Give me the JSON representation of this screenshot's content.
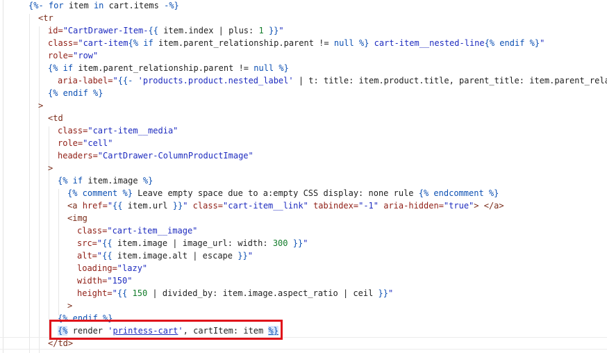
{
  "editor": {
    "highlight_color": "#e0131a",
    "lines": [
      [
        [
          "lq",
          "{%- "
        ],
        [
          "kw",
          "for"
        ],
        [
          "var",
          " item "
        ],
        [
          "kw",
          "in"
        ],
        [
          "var",
          " cart.items "
        ],
        [
          "lq",
          "-%}"
        ]
      ],
      [
        [
          "tag",
          "<tr"
        ]
      ],
      [
        [
          "attr",
          "id="
        ],
        [
          "str",
          "\"CartDrawer-Item-"
        ],
        [
          "lq",
          "{{"
        ],
        [
          "var",
          " item.index "
        ],
        [
          "txt",
          "| "
        ],
        [
          "flt",
          "plus"
        ],
        [
          "txt",
          ": "
        ],
        [
          "num",
          "1"
        ],
        [
          "lq",
          " }}"
        ],
        [
          "str",
          "\""
        ]
      ],
      [
        [
          "attr",
          "class="
        ],
        [
          "str",
          "\"cart-item"
        ],
        [
          "lq",
          "{%"
        ],
        [
          "kw",
          " if"
        ],
        [
          "var",
          " item.parent_relationship.parent "
        ],
        [
          "txt",
          "!= "
        ],
        [
          "kw",
          "null"
        ],
        [
          "lq",
          " %}"
        ],
        [
          "str",
          " cart-item__nested-line"
        ],
        [
          "lq",
          "{%"
        ],
        [
          "kw",
          " endif"
        ],
        [
          "lq",
          " %}"
        ],
        [
          "str",
          "\""
        ]
      ],
      [
        [
          "attr",
          "role="
        ],
        [
          "str",
          "\"row\""
        ]
      ],
      [
        [
          "lq",
          "{%"
        ],
        [
          "kw",
          " if"
        ],
        [
          "var",
          " item.parent_relationship.parent "
        ],
        [
          "txt",
          "!= "
        ],
        [
          "kw",
          "null"
        ],
        [
          "lq",
          " %}"
        ]
      ],
      [
        [
          "attr",
          "aria-label="
        ],
        [
          "str",
          "\""
        ],
        [
          "lq",
          "{{-"
        ],
        [
          "str",
          " 'products.product.nested_label'"
        ],
        [
          "txt",
          " | "
        ],
        [
          "flt",
          "t"
        ],
        [
          "txt",
          ": "
        ],
        [
          "flt",
          "title"
        ],
        [
          "txt",
          ": "
        ],
        [
          "var",
          "item.product.title"
        ],
        [
          "txt",
          ", "
        ],
        [
          "flt",
          "parent_title"
        ],
        [
          "txt",
          ": "
        ],
        [
          "var",
          "item.parent_rela"
        ]
      ],
      [
        [
          "lq",
          "{%"
        ],
        [
          "kw",
          " endif"
        ],
        [
          "lq",
          " %}"
        ]
      ],
      [
        [
          "tag",
          ">"
        ]
      ],
      [
        [
          "tag",
          "<td"
        ]
      ],
      [
        [
          "attr",
          "class="
        ],
        [
          "str",
          "\"cart-item__media\""
        ]
      ],
      [
        [
          "attr",
          "role="
        ],
        [
          "str",
          "\"cell\""
        ]
      ],
      [
        [
          "attr",
          "headers="
        ],
        [
          "str",
          "\"CartDrawer-ColumnProductImage\""
        ]
      ],
      [
        [
          "tag",
          ">"
        ]
      ],
      [
        [
          "lq",
          "{%"
        ],
        [
          "kw",
          " if"
        ],
        [
          "var",
          " item.image "
        ],
        [
          "lq",
          "%}"
        ]
      ],
      [
        [
          "lq",
          "{%"
        ],
        [
          "kw",
          " comment"
        ],
        [
          "lq",
          " %}"
        ],
        [
          "txt",
          " Leave empty space due to a:empty CSS display: none rule "
        ],
        [
          "lq",
          "{%"
        ],
        [
          "kw",
          " endcomment"
        ],
        [
          "lq",
          " %}"
        ]
      ],
      [
        [
          "tag",
          "<a "
        ],
        [
          "attr",
          "href="
        ],
        [
          "str",
          "\""
        ],
        [
          "lq",
          "{{"
        ],
        [
          "var",
          " item.url "
        ],
        [
          "lq",
          "}}"
        ],
        [
          "str",
          "\""
        ],
        [
          "attr",
          " class="
        ],
        [
          "str",
          "\"cart-item__link\""
        ],
        [
          "attr",
          " tabindex="
        ],
        [
          "str",
          "\"-1\""
        ],
        [
          "attr",
          " aria-hidden="
        ],
        [
          "str",
          "\"true\""
        ],
        [
          "tag",
          "> </a>"
        ]
      ],
      [
        [
          "tag",
          "<img"
        ]
      ],
      [
        [
          "attr",
          "class="
        ],
        [
          "str",
          "\"cart-item__image\""
        ]
      ],
      [
        [
          "attr",
          "src="
        ],
        [
          "str",
          "\""
        ],
        [
          "lq",
          "{{"
        ],
        [
          "var",
          " item.image "
        ],
        [
          "txt",
          "| "
        ],
        [
          "flt",
          "image_url"
        ],
        [
          "txt",
          ": "
        ],
        [
          "flt",
          "width"
        ],
        [
          "txt",
          ": "
        ],
        [
          "num",
          "300"
        ],
        [
          "lq",
          " }}"
        ],
        [
          "str",
          "\""
        ]
      ],
      [
        [
          "attr",
          "alt="
        ],
        [
          "str",
          "\""
        ],
        [
          "lq",
          "{{"
        ],
        [
          "var",
          " item.image.alt "
        ],
        [
          "txt",
          "| "
        ],
        [
          "flt",
          "escape"
        ],
        [
          "lq",
          " }}"
        ],
        [
          "str",
          "\""
        ]
      ],
      [
        [
          "attr",
          "loading="
        ],
        [
          "str",
          "\"lazy\""
        ]
      ],
      [
        [
          "attr",
          "width="
        ],
        [
          "str",
          "\"150\""
        ]
      ],
      [
        [
          "attr",
          "height="
        ],
        [
          "str",
          "\""
        ],
        [
          "lq",
          "{{"
        ],
        [
          "num",
          " 150"
        ],
        [
          "txt",
          " | "
        ],
        [
          "flt",
          "divided_by"
        ],
        [
          "txt",
          ": "
        ],
        [
          "var",
          "item.image.aspect_ratio"
        ],
        [
          "txt",
          " | "
        ],
        [
          "flt",
          "ceil"
        ],
        [
          "lq",
          " }}"
        ],
        [
          "str",
          "\""
        ]
      ],
      [
        [
          "tag",
          ">"
        ]
      ],
      [
        [
          "lq",
          "{%"
        ],
        [
          "kw",
          " endif"
        ],
        [
          "lq",
          " %}"
        ]
      ],
      [
        [
          "lq",
          "{%"
        ],
        [
          "txt",
          " render "
        ],
        [
          "str",
          "'"
        ],
        [
          "str",
          "printess-cart"
        ],
        [
          "str",
          "'"
        ],
        [
          "txt",
          ", "
        ],
        [
          "flt",
          "cartItem"
        ],
        [
          "txt",
          ": "
        ],
        [
          "var",
          "item "
        ],
        [
          "lq",
          "%}"
        ]
      ],
      [
        [
          "tag",
          "</td>"
        ]
      ]
    ]
  }
}
